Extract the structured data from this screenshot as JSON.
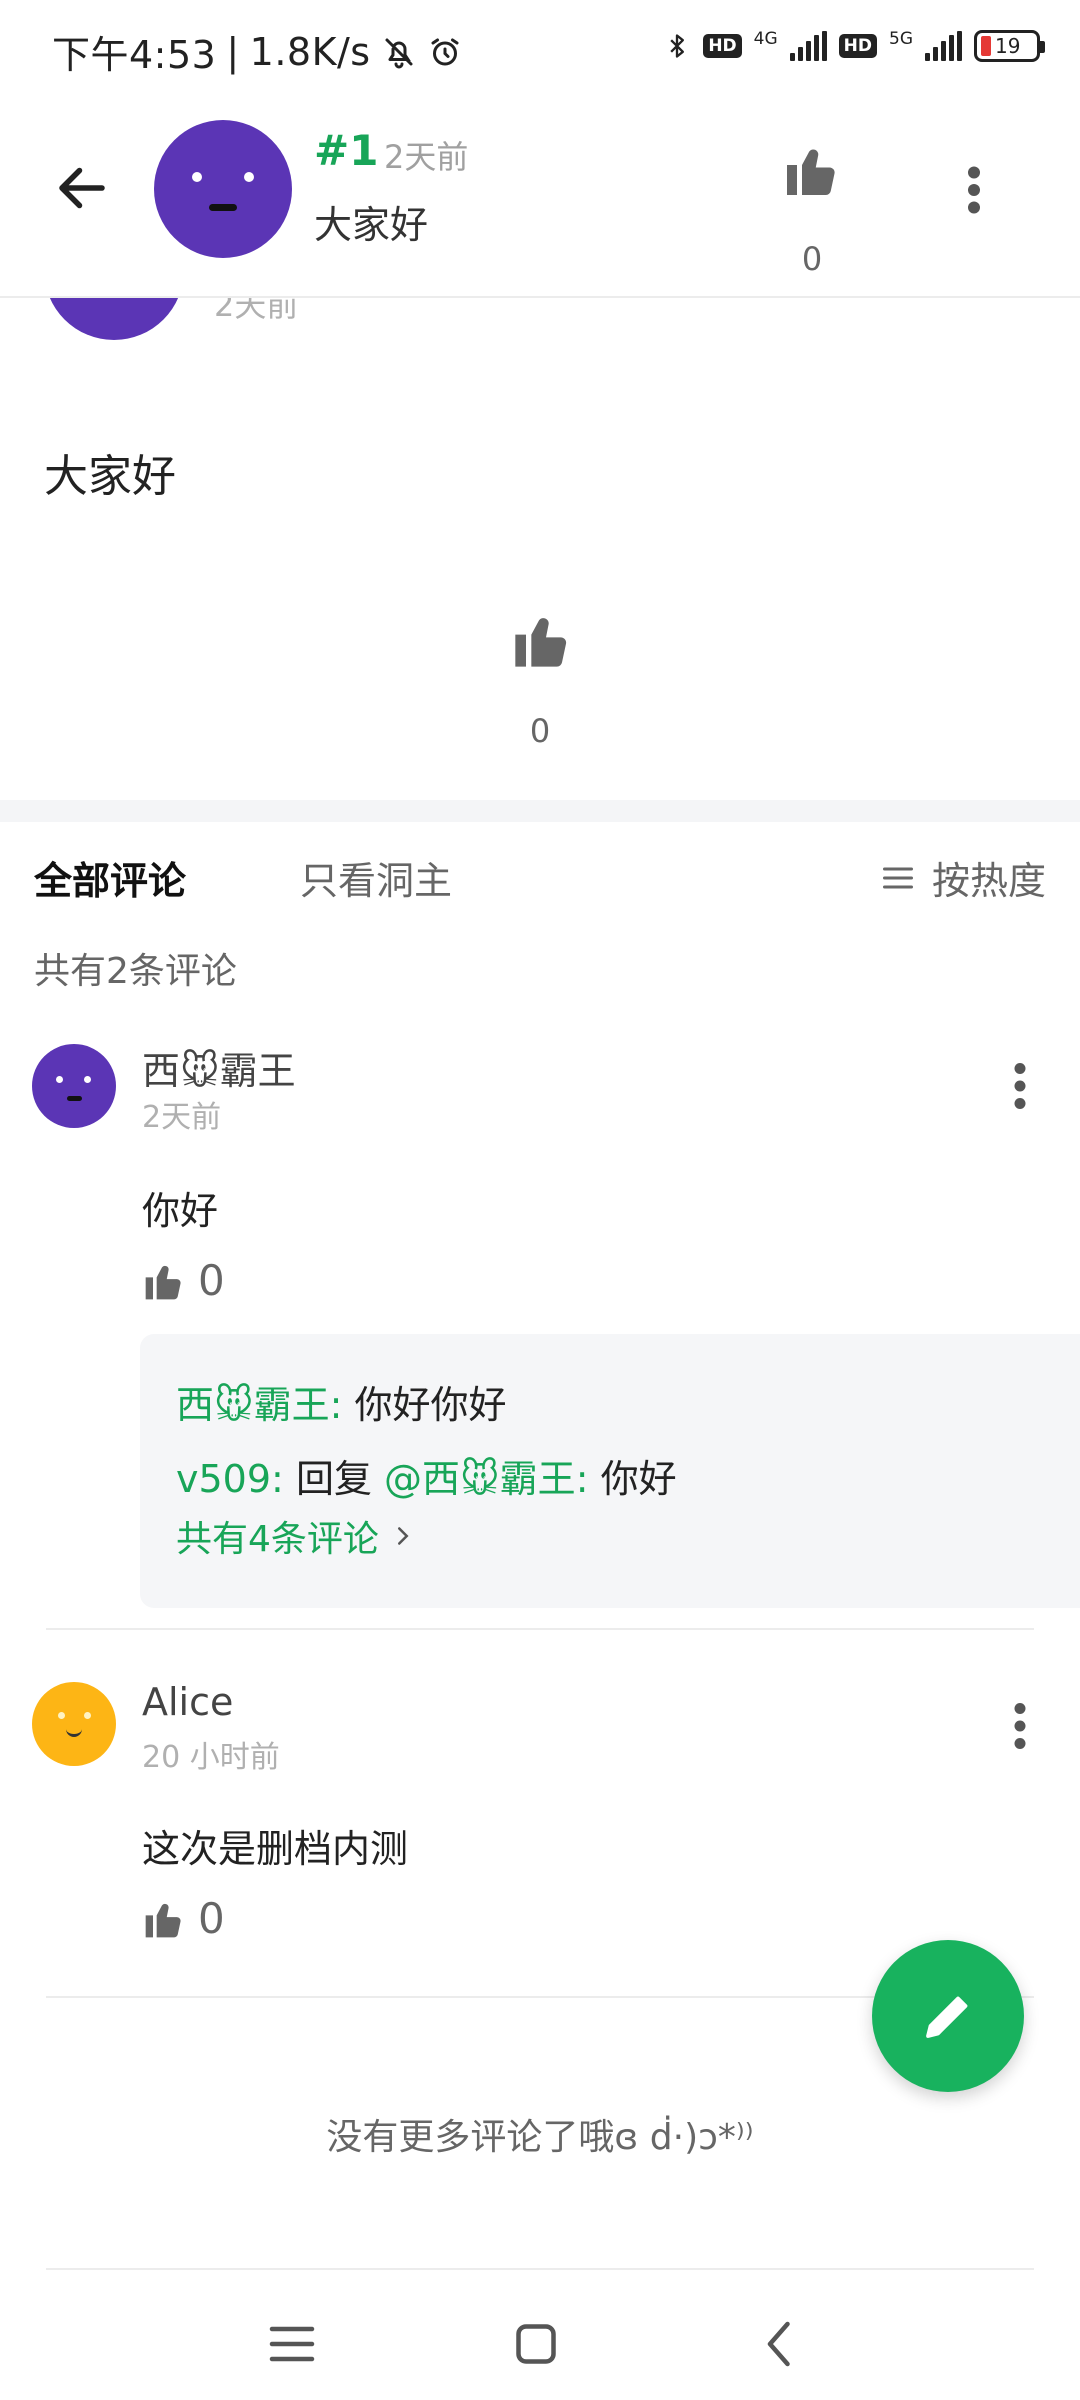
{
  "status_bar": {
    "time": "下午4:53",
    "net_speed": "1.8K/s",
    "net1": "4G",
    "net2": "5G",
    "hd": "HD",
    "battery": "19"
  },
  "header": {
    "post_number": "#1",
    "post_time": "2天前",
    "post_text": "大家好",
    "like_count": "0"
  },
  "post": {
    "time": "2天前",
    "content": "大家好",
    "like_count": "0"
  },
  "tabs": {
    "all": "全部评论",
    "owner_only": "只看洞主",
    "sort": "按热度"
  },
  "comment_count_text": "共有2条评论",
  "comments": [
    {
      "name": "西🐭霸王",
      "time": "2天前",
      "text": "你好",
      "likes": "0",
      "replies": [
        {
          "author": "西🐭霸王",
          "sep": ":",
          "text": "你好你好"
        },
        {
          "author": "v509",
          "sep": ":",
          "reply_label": "回复",
          "mention": "@西🐭霸王",
          "text": "你好"
        }
      ],
      "more_replies": "共有4条评论"
    },
    {
      "name": "Alice",
      "time": "20 小时前",
      "text": "这次是删档内测",
      "likes": "0"
    }
  ],
  "end_text": "没有更多评论了哦ɞ ḋ·)ɔ*⁾⁾",
  "colors": {
    "accent": "#18a558",
    "fab": "#18b25e",
    "avatar_purple": "#5b35b5",
    "avatar_yellow": "#fdb515"
  },
  "icons": [
    "back-arrow-icon",
    "thumbs-up-icon",
    "more-vertical-icon",
    "sort-lines-icon",
    "chevron-right-icon",
    "pencil-icon",
    "menu-icon",
    "home-square-icon",
    "nav-back-icon"
  ]
}
